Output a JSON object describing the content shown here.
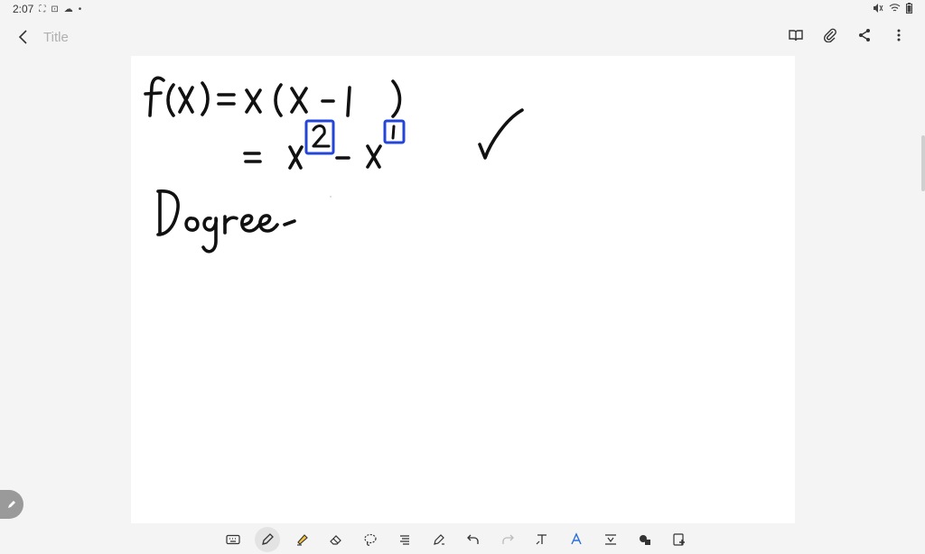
{
  "status_bar": {
    "time": "2:07"
  },
  "app_bar": {
    "title_placeholder": "Title"
  },
  "note": {
    "line1": "f(x) = x (x - 1)",
    "line2": "= x2 - x1",
    "line3": "Degree -"
  },
  "toolbar": {
    "tools": [
      "keyboard-icon",
      "pen-icon",
      "highlighter-icon",
      "eraser-icon",
      "lasso-icon",
      "text-align-icon",
      "pen-settings-icon",
      "undo-icon",
      "redo-icon",
      "text-mode-icon",
      "handwriting-icon",
      "spacing-icon",
      "shapes-icon",
      "insert-icon"
    ],
    "selected": "pen-icon"
  },
  "colors": {
    "ink": "#111111",
    "box_highlight": "#2346d6",
    "canvas": "#ffffff",
    "background": "#f4f4f4"
  }
}
